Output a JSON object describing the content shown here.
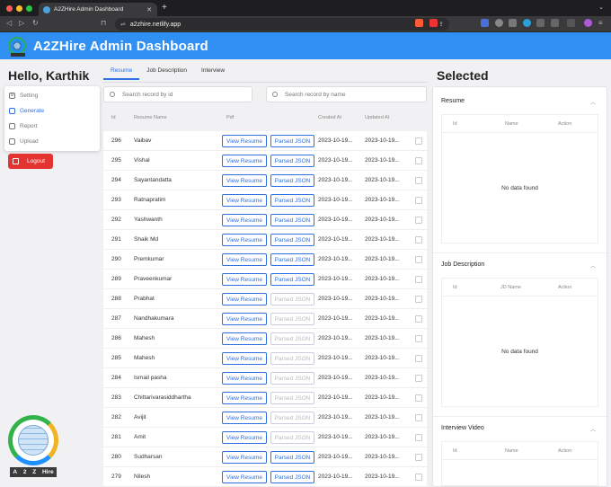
{
  "browser": {
    "tab_title": "A2ZHire Admin Dashboard",
    "url": "a2zhire.netlify.app"
  },
  "app": {
    "title": "A2ZHire Admin Dashboard",
    "greeting": "Hello, Karthik",
    "brand_color": "#2f8ff2"
  },
  "menu": {
    "items": [
      {
        "label": "Setting",
        "icon": "gear-icon"
      },
      {
        "label": "Generate",
        "icon": "generate-icon"
      },
      {
        "label": "Report",
        "icon": "report-icon"
      },
      {
        "label": "Upload",
        "icon": "upload-icon"
      }
    ],
    "logout": "Logout"
  },
  "logo_text": [
    "A",
    "2",
    "Z",
    "Hire"
  ],
  "tabs": [
    "Resume",
    "Job Description",
    "Interview"
  ],
  "search": {
    "id_placeholder": "Search record by id",
    "name_placeholder": "Search record by name"
  },
  "table": {
    "headers": {
      "id": "Id",
      "name": "Resume Name",
      "pdf": "Pdf",
      "created": "Created At",
      "updated": "Updated At"
    },
    "view_label": "View Resume",
    "json_label": "Parsed JSON",
    "rows": [
      {
        "id": "296",
        "name": "Vaibav",
        "created": "2023-10-19...",
        "updated": "2023-10-19...",
        "json_enabled": true
      },
      {
        "id": "295",
        "name": "Vishal",
        "created": "2023-10-19...",
        "updated": "2023-10-19...",
        "json_enabled": true
      },
      {
        "id": "294",
        "name": "Sayantandatta",
        "created": "2023-10-19...",
        "updated": "2023-10-19...",
        "json_enabled": true
      },
      {
        "id": "293",
        "name": "Ratnapratim",
        "created": "2023-10-19...",
        "updated": "2023-10-19...",
        "json_enabled": true
      },
      {
        "id": "292",
        "name": "Yashwanth",
        "created": "2023-10-19...",
        "updated": "2023-10-19...",
        "json_enabled": true
      },
      {
        "id": "291",
        "name": "Shaik Md",
        "created": "2023-10-19...",
        "updated": "2023-10-19...",
        "json_enabled": true
      },
      {
        "id": "290",
        "name": "Premkumar",
        "created": "2023-10-19...",
        "updated": "2023-10-19...",
        "json_enabled": true
      },
      {
        "id": "289",
        "name": "Praveenkumar",
        "created": "2023-10-19...",
        "updated": "2023-10-19...",
        "json_enabled": true
      },
      {
        "id": "288",
        "name": "Prabhat",
        "created": "2023-10-19...",
        "updated": "2023-10-19...",
        "json_enabled": false
      },
      {
        "id": "287",
        "name": "Nandhakumara",
        "created": "2023-10-19...",
        "updated": "2023-10-19...",
        "json_enabled": false
      },
      {
        "id": "286",
        "name": "Mahesh",
        "created": "2023-10-19...",
        "updated": "2023-10-19...",
        "json_enabled": false
      },
      {
        "id": "285",
        "name": "Mahesh",
        "created": "2023-10-19...",
        "updated": "2023-10-19...",
        "json_enabled": false
      },
      {
        "id": "284",
        "name": "Ismail pasha",
        "created": "2023-10-19...",
        "updated": "2023-10-19...",
        "json_enabled": false
      },
      {
        "id": "283",
        "name": "Chittarivarasiddhartha",
        "created": "2023-10-19...",
        "updated": "2023-10-19...",
        "json_enabled": false
      },
      {
        "id": "282",
        "name": "Avijit",
        "created": "2023-10-19...",
        "updated": "2023-10-19...",
        "json_enabled": false
      },
      {
        "id": "281",
        "name": "Amit",
        "created": "2023-10-19...",
        "updated": "2023-10-19...",
        "json_enabled": false
      },
      {
        "id": "280",
        "name": "Sudharsan",
        "created": "2023-10-19...",
        "updated": "2023-10-19...",
        "json_enabled": true
      },
      {
        "id": "279",
        "name": "Nilesh",
        "created": "2023-10-19...",
        "updated": "2023-10-19...",
        "json_enabled": true
      }
    ]
  },
  "selected": {
    "title": "Selected",
    "sections": [
      {
        "title": "Resume",
        "cols": [
          "Id",
          "Name",
          "Action"
        ],
        "empty": "No data found"
      },
      {
        "title": "Job Description",
        "cols": [
          "Id",
          "JD Name",
          "Action"
        ],
        "empty": "No data found"
      },
      {
        "title": "Interview Video",
        "cols": [
          "Id",
          "Name",
          "Action"
        ],
        "empty": ""
      }
    ]
  }
}
